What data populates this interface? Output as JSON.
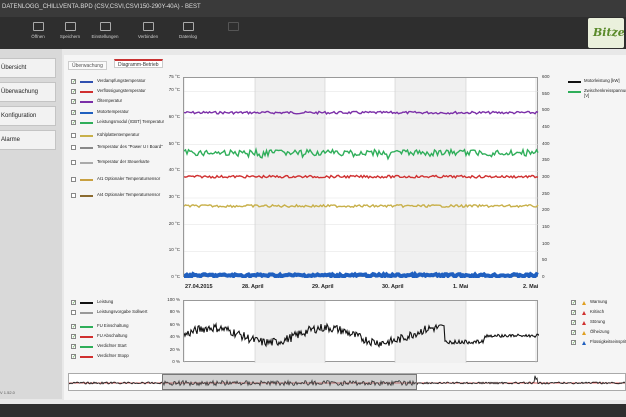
{
  "window": {
    "title": "DATENLOGG_CHILLVENTA.BPD (CSV,CSVI,CSVI150-290Y-40A) - BEST"
  },
  "toolbar": {
    "items": [
      "Öffnen",
      "Speichern",
      "Einstellungen",
      "Verbinden",
      "Datenlog"
    ],
    "logo_text": "Bitzer"
  },
  "sidebar": {
    "items": [
      "Übersicht",
      "Überwachung",
      "Konfiguration",
      "Alarme"
    ],
    "version": "V 1.52.0"
  },
  "tabs": [
    "Überwachung",
    "Diagramm-Betrieb"
  ],
  "colors": {
    "purple": "#7b2fa8",
    "green": "#2fae5a",
    "red": "#d03030",
    "blue": "#2060c0",
    "olive": "#c8b04a",
    "brown": "#8a6a30",
    "black": "#111111",
    "accent": "#c83232"
  },
  "legend_top": [
    {
      "label": "Verdampfungstemperatur",
      "color": "#3050b0",
      "checked": true
    },
    {
      "label": "Verflüssigungstemperatur",
      "color": "#d03030",
      "checked": true
    },
    {
      "label": "Öltemperatur",
      "color": "#7b2fa8",
      "checked": true
    },
    {
      "label": "Motortemperatur",
      "color": "#2060c0",
      "checked": true
    },
    {
      "label": "Leistungsmodul (IGBT) Temperatur",
      "color": "#2fae5a",
      "checked": true
    },
    {
      "label": "Kühlplattentemperatur",
      "color": "#c8b04a",
      "checked": false
    },
    {
      "label": "Temperatur des \"Power U I Board\"",
      "color": "#888888",
      "checked": false
    },
    {
      "label": "Temperatur der Steuerkarte",
      "color": "#aaaaaa",
      "checked": false
    },
    {
      "label": "AI1 Optionaler Temperatursensor",
      "color": "#c8a040",
      "checked": false
    },
    {
      "label": "AI4 Optionaler Temperatursensor",
      "color": "#8a6a30",
      "checked": false
    }
  ],
  "legend_right": [
    {
      "label": "Motorleistung [kW]",
      "color": "#111111"
    },
    {
      "label": "Zwischenkreisspannung [V]",
      "color": "#2fae5a"
    }
  ],
  "legend_bottom": [
    {
      "label": "Leistung",
      "color": "#111111",
      "checked": true
    },
    {
      "label": "Leistungsvorgabe Sollwert",
      "color": "#999999",
      "checked": false
    },
    {
      "label": "FU Einschaltung",
      "color": "#2fae5a",
      "checked": true
    },
    {
      "label": "FU Abschaltung",
      "color": "#d03030",
      "checked": true
    },
    {
      "label": "Verdichter Start",
      "color": "#2fae5a",
      "checked": true
    },
    {
      "label": "Verdichter Stopp",
      "color": "#d03030",
      "checked": true
    }
  ],
  "legend_events": [
    {
      "label": "Warnung",
      "color": "#e0a020"
    },
    {
      "label": "Kritisch",
      "color": "#d03030"
    },
    {
      "label": "Störung",
      "color": "#d03030"
    },
    {
      "label": "Ölheizung",
      "color": "#e0a020"
    },
    {
      "label": "Flüssigkeitseinspritzung",
      "color": "#2060c0"
    }
  ],
  "chart_data": [
    {
      "type": "line",
      "x": [
        "27.04.2015",
        "28. April",
        "29. April",
        "30. April",
        "1. Mai",
        "2. Mai"
      ],
      "yleft": {
        "ticks": [
          "0 °C",
          "10 °C",
          "20 °C",
          "30 °C",
          "40 °C",
          "50 °C",
          "60 °C",
          "70 °C",
          "75 °C"
        ],
        "ylim": [
          0,
          75
        ]
      },
      "yright": {
        "ticks": [
          "0",
          "50",
          "100",
          "150",
          "200",
          "250",
          "300",
          "350",
          "400",
          "450",
          "500",
          "550",
          "600"
        ],
        "ylim": [
          0,
          600
        ]
      },
      "series": [
        {
          "name": "Öltemperatur",
          "color": "#7b2fa8",
          "level": 62
        },
        {
          "name": "Leistungsmodul (IGBT) Temperatur",
          "color": "#2fae5a",
          "level": 47
        },
        {
          "name": "Verflüssigungstemperatur",
          "color": "#d03030",
          "level": 38
        },
        {
          "name": "Kühlplattentemperatur",
          "color": "#c8b04a",
          "level": 27
        },
        {
          "name": "Motortemperatur",
          "color": "#2060c0",
          "level": 1
        }
      ]
    },
    {
      "type": "line",
      "yleft": {
        "ticks": [
          "0 %",
          "20 %",
          "40 %",
          "60 %",
          "80 %",
          "100 %"
        ],
        "ylim": [
          0,
          100
        ]
      },
      "series": [
        {
          "name": "Leistung",
          "color": "#111111",
          "level": 45
        }
      ]
    }
  ]
}
